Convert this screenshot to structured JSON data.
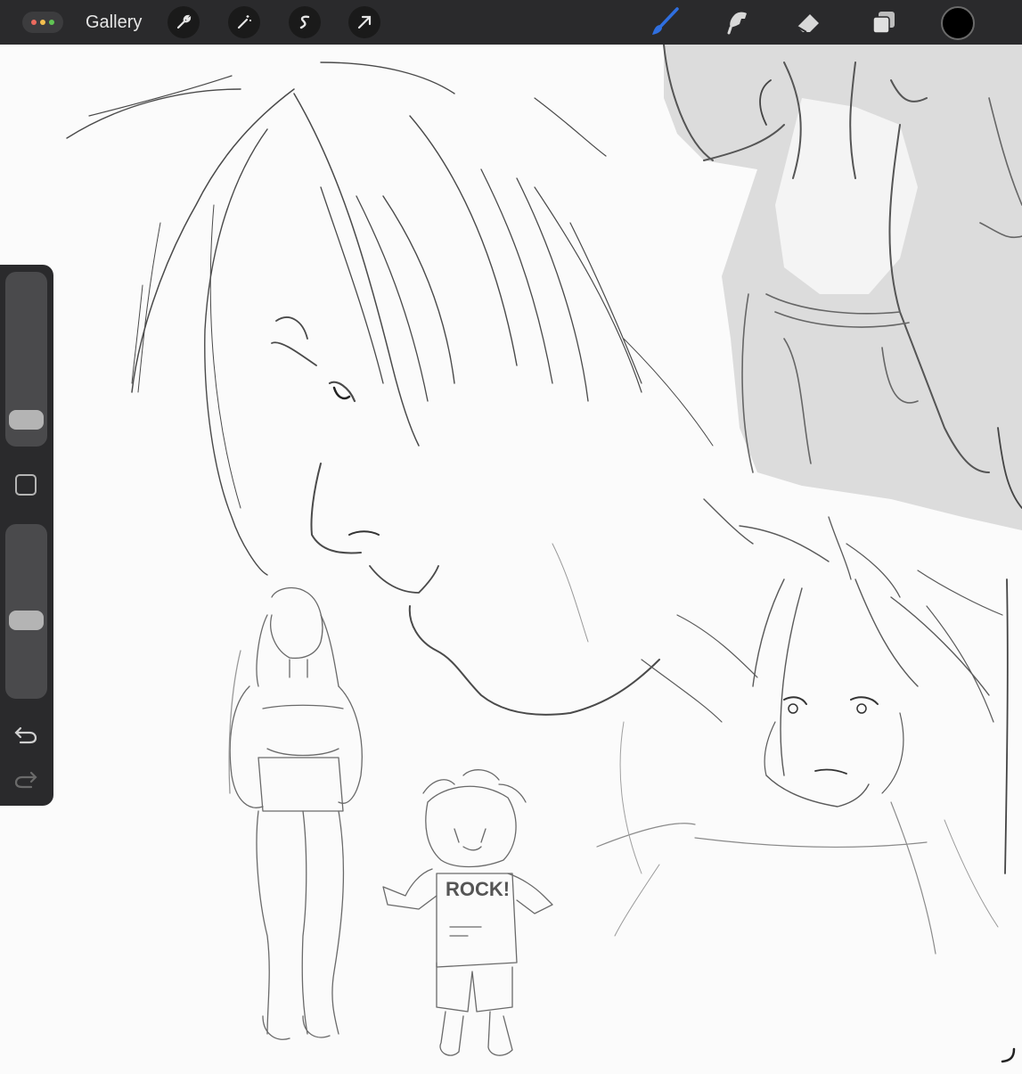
{
  "app": {
    "gallery_label": "Gallery",
    "accent_color": "#2f6fe0",
    "window_dots": [
      "#ec6a5e",
      "#f4bf4f",
      "#61c554"
    ]
  },
  "toolbar": {
    "left_tools": [
      "wrench-icon",
      "magic-wand-icon",
      "selection-s-icon",
      "transform-arrow-icon"
    ],
    "right_tools": [
      "brush-icon",
      "smudge-icon",
      "eraser-icon",
      "layers-icon"
    ],
    "active_tool": "brush",
    "current_color": "#000000"
  },
  "sidebar": {
    "brush_size_level": 0.2,
    "opacity_level": 0.45,
    "buttons": [
      "modify-button",
      "undo-icon",
      "redo-icon"
    ]
  },
  "canvas": {
    "text_on_sketch": "ROCK!"
  }
}
